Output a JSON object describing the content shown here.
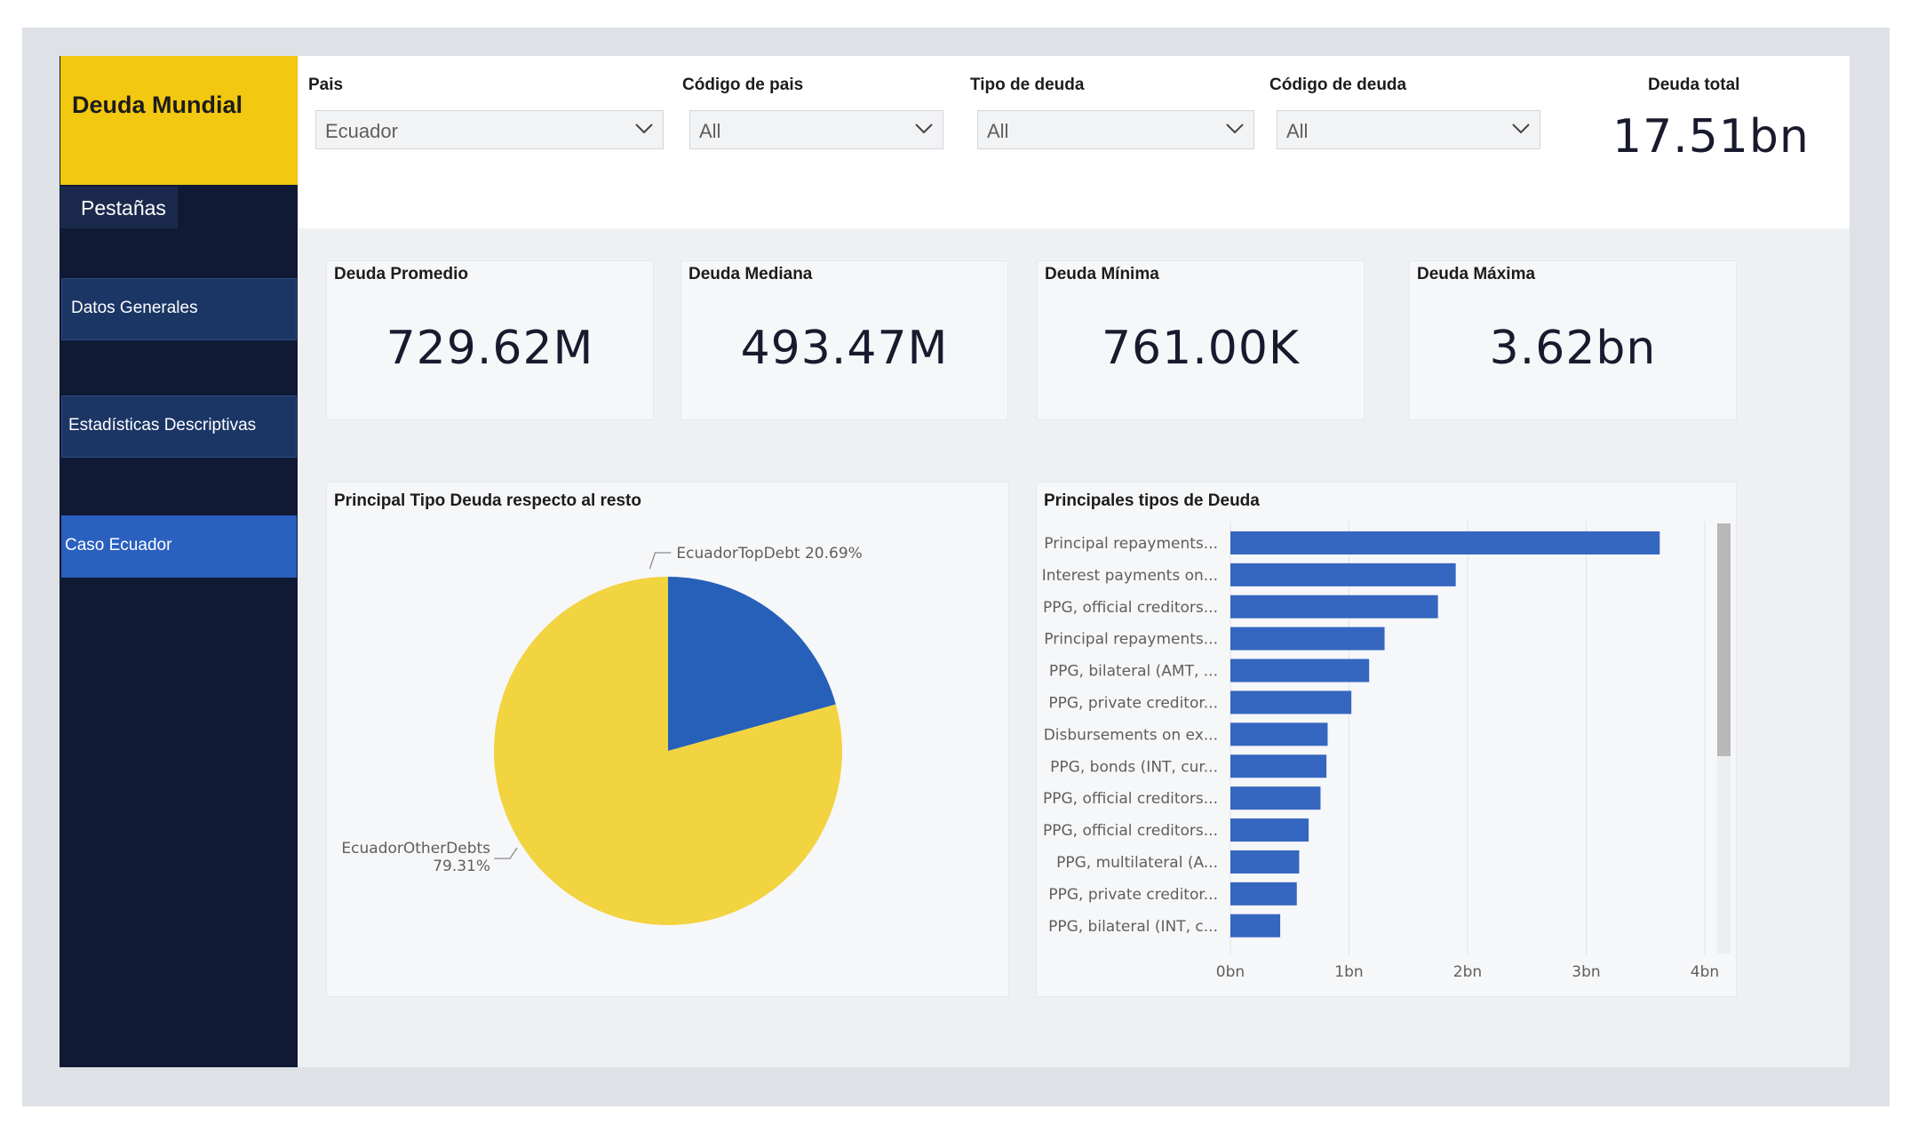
{
  "app": {
    "title": "Deuda Mundial",
    "tabs_label": "Pestañas",
    "nav": [
      {
        "label": "Datos Generales",
        "active": false
      },
      {
        "label": "Estadísticas Descriptivas",
        "active": false
      },
      {
        "label": "Caso Ecuador",
        "active": true
      }
    ]
  },
  "filters": [
    {
      "label": "Pais",
      "value": "Ecuador"
    },
    {
      "label": "Código de pais",
      "value": "All"
    },
    {
      "label": "Tipo de deuda",
      "value": "All"
    },
    {
      "label": "Código de deuda",
      "value": "All"
    }
  ],
  "total": {
    "label": "Deuda total",
    "value": "17.51bn"
  },
  "kpis": [
    {
      "label": "Deuda Promedio",
      "value": "729.62M"
    },
    {
      "label": "Deuda Mediana",
      "value": "493.47M"
    },
    {
      "label": "Deuda Mínima",
      "value": "761.00K"
    },
    {
      "label": "Deuda Máxima",
      "value": "3.62bn"
    }
  ],
  "colors": {
    "brand_yellow": "#f2c811",
    "sidebar_navy": "#101a34",
    "nav_active": "#2a60c0",
    "pie_top": "#2660b8",
    "pie_other": "#f2d340",
    "bar": "#3566c0"
  },
  "chart_data": [
    {
      "type": "pie",
      "title": "Principal Tipo Deuda respecto al resto",
      "slices": [
        {
          "label": "EcuadorTopDebt",
          "value": 20.69,
          "display": "20.69%",
          "color": "#2660b8"
        },
        {
          "label": "EcuadorOtherDebts",
          "value": 79.31,
          "display": "79.31%",
          "color": "#f2d340"
        }
      ]
    },
    {
      "type": "bar",
      "orientation": "horizontal",
      "title": "Principales tipos de Deuda",
      "categories": [
        "Principal repayments...",
        "Interest payments on...",
        "PPG, official creditors...",
        "Principal repayments...",
        "PPG, bilateral (AMT, ...",
        "PPG, private creditor...",
        "Disbursements on ex...",
        "PPG, bonds (INT, cur...",
        "PPG, official creditors...",
        "PPG, official creditors...",
        "PPG, multilateral (A...",
        "PPG, private creditor...",
        "PPG, bilateral (INT, c..."
      ],
      "values": [
        3.62,
        1.9,
        1.75,
        1.3,
        1.17,
        1.02,
        0.82,
        0.81,
        0.76,
        0.66,
        0.58,
        0.56,
        0.42
      ],
      "unit": "bn",
      "xlim": [
        0,
        4
      ],
      "xticks": [
        "0bn",
        "1bn",
        "2bn",
        "3bn",
        "4bn"
      ],
      "grid": true,
      "scrollbar": true
    }
  ]
}
